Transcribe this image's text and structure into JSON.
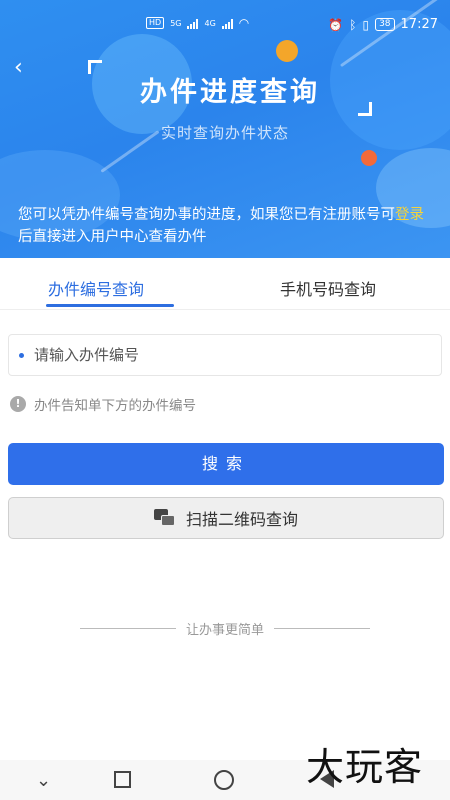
{
  "status_bar": {
    "time": "17:27",
    "battery": "38",
    "network_labels": [
      "HD",
      "5G",
      "4G"
    ]
  },
  "header": {
    "title": "办件进度查询",
    "subtitle": "实时查询办件状态",
    "intro_before": "您可以凭办件编号查询办事的进度，如果您已有注册账号可",
    "intro_link": "登录",
    "intro_after": "后直接进入用户中心查看办件",
    "link_color": "#f5d33a",
    "brand_color": "#2f8ff0"
  },
  "tabs": [
    {
      "label": "办件编号查询",
      "active": true
    },
    {
      "label": "手机号码查询",
      "active": false
    }
  ],
  "form": {
    "input_placeholder": "请输入办件编号",
    "input_value": "",
    "hint": "办件告知单下方的办件编号"
  },
  "buttons": {
    "search": "搜索",
    "scan": "扫描二维码查询"
  },
  "footer": {
    "slogan": "让办事更简单",
    "watermark": "大玩客"
  },
  "icons": [
    "back-icon",
    "info-icon",
    "scan-qr-icon",
    "nav-back-icon",
    "nav-recent-icon",
    "nav-home-icon",
    "nav-triangle-icon"
  ]
}
